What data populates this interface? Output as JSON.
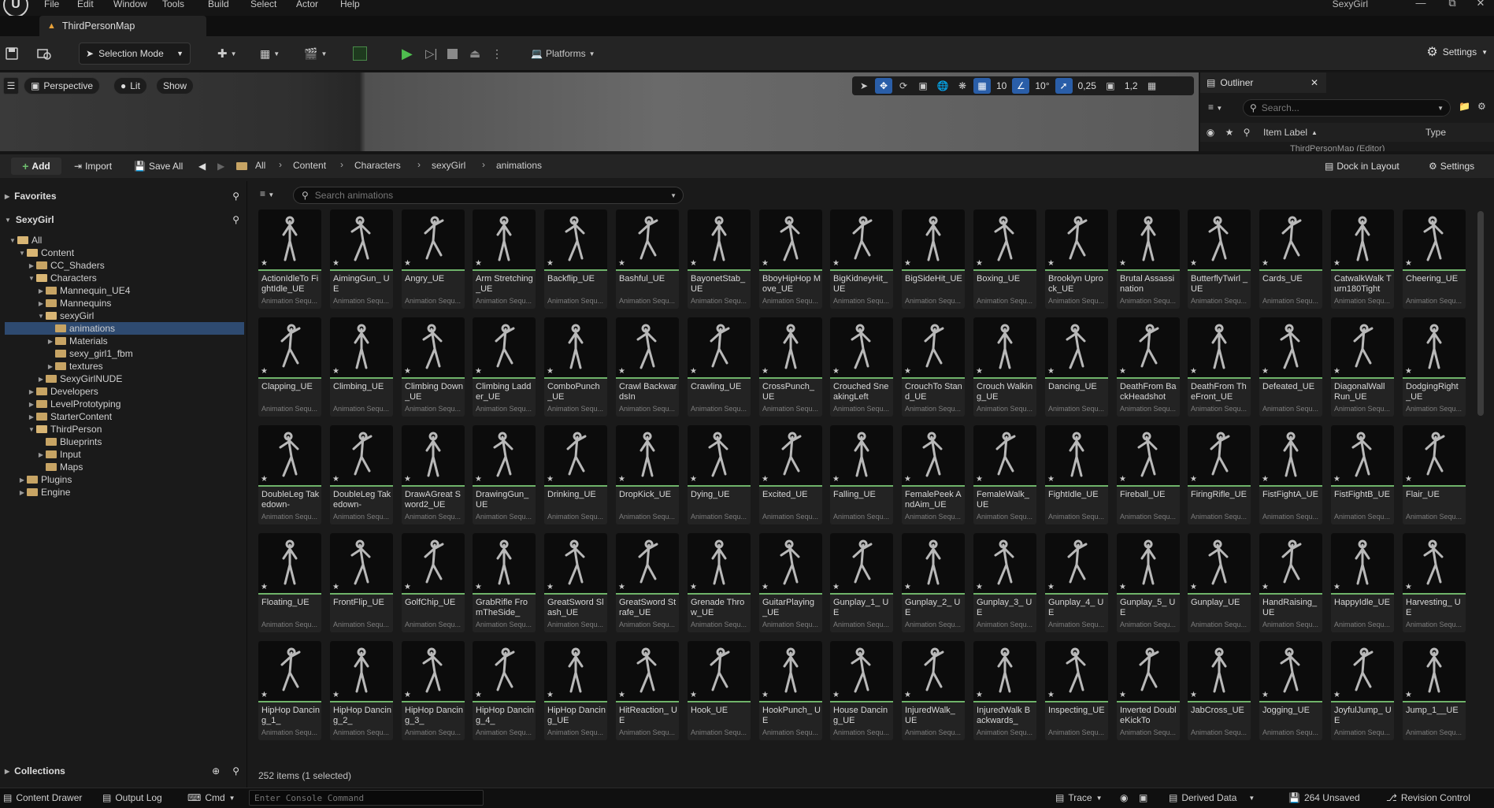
{
  "menu": {
    "items": [
      "File",
      "Edit",
      "Window",
      "Tools",
      "Build",
      "Select",
      "Actor",
      "Help"
    ],
    "project": "SexyGirl"
  },
  "tab": {
    "label": "ThirdPersonMap"
  },
  "toolbar": {
    "selection_mode": "Selection Mode",
    "platforms": "Platforms",
    "settings": "Settings"
  },
  "viewport": {
    "perspective": "Perspective",
    "lit": "Lit",
    "show": "Show",
    "grid_snap": "10",
    "rotation_snap": "10°",
    "scale_snap": "0,25",
    "camera_speed": "1,2"
  },
  "outliner": {
    "title": "Outliner",
    "search_placeholder": "Search...",
    "col_label": "Item Label",
    "col_type": "Type",
    "first_row": "ThirdPersonMap (Editor)"
  },
  "content_browser": {
    "add": "Add",
    "import": "Import",
    "save_all": "Save All",
    "breadcrumb": [
      "All",
      "Content",
      "Characters",
      "sexyGirl",
      "animations"
    ],
    "dock": "Dock in Layout",
    "settings": "Settings",
    "favorites": "Favorites",
    "project_root": "SexyGirl",
    "search_placeholder": "Search animations",
    "items_count": "252 items (1 selected)",
    "collections": "Collections",
    "asset_type": "Animation Sequ..."
  },
  "tree": [
    {
      "label": "All",
      "depth": 0,
      "open": true
    },
    {
      "label": "Content",
      "depth": 1,
      "open": true
    },
    {
      "label": "CC_Shaders",
      "depth": 2
    },
    {
      "label": "Characters",
      "depth": 2,
      "open": true
    },
    {
      "label": "Mannequin_UE4",
      "depth": 3
    },
    {
      "label": "Mannequins",
      "depth": 3
    },
    {
      "label": "sexyGirl",
      "depth": 3,
      "open": true
    },
    {
      "label": "animations",
      "depth": 4,
      "selected": true
    },
    {
      "label": "Materials",
      "depth": 4
    },
    {
      "label": "sexy_girl1_fbm",
      "depth": 4
    },
    {
      "label": "textures",
      "depth": 4
    },
    {
      "label": "SexyGirlNUDE",
      "depth": 3
    },
    {
      "label": "Developers",
      "depth": 2
    },
    {
      "label": "LevelPrototyping",
      "depth": 2
    },
    {
      "label": "StarterContent",
      "depth": 2
    },
    {
      "label": "ThirdPerson",
      "depth": 2,
      "open": true
    },
    {
      "label": "Blueprints",
      "depth": 3
    },
    {
      "label": "Input",
      "depth": 3
    },
    {
      "label": "Maps",
      "depth": 3
    },
    {
      "label": "Plugins",
      "depth": 1
    },
    {
      "label": "Engine",
      "depth": 1
    }
  ],
  "assets": [
    "ActionIdleTo FightIdle_UE",
    "AimingGun_ UE",
    "Angry_UE",
    "Arm Stretching_UE",
    "Backflip_UE",
    "Bashful_UE",
    "BayonetStab_ UE",
    "BboyHipHop Move_UE",
    "BigKidneyHit_ UE",
    "BigSideHit_UE",
    "Boxing_UE",
    "Brooklyn Uprock_UE",
    "Brutal Assassination",
    "ButterflyTwirl _UE",
    "Cards_UE",
    "CatwalkWalk Turn180Tight",
    "Cheering_UE",
    "Clapping_UE",
    "Climbing_UE",
    "Climbing Down_UE",
    "Climbing Ladder_UE",
    "ComboPunch _UE",
    "Crawl BackwardsIn",
    "Crawling_UE",
    "CrossPunch_ UE",
    "Crouched SneakingLeft",
    "CrouchTo Stand_UE",
    "Crouch Walking_UE",
    "Dancing_UE",
    "DeathFrom BackHeadshot",
    "DeathFrom TheFront_UE",
    "Defeated_UE",
    "DiagonalWall Run_UE",
    "DodgingRight _UE",
    "DoubleLeg Takedown-",
    "DoubleLeg Takedown-",
    "DrawAGreat Sword2_UE",
    "DrawingGun_ UE",
    "Drinking_UE",
    "DropKick_UE",
    "Dying_UE",
    "Excited_UE",
    "Falling_UE",
    "FemalePeek AndAim_UE",
    "FemaleWalk_ UE",
    "FightIdle_UE",
    "Fireball_UE",
    "FiringRifle_UE",
    "FistFightA_UE",
    "FistFightB_UE",
    "Flair_UE",
    "Floating_UE",
    "FrontFlip_UE",
    "GolfChip_UE",
    "GrabRifle FromTheSide_",
    "GreatSword Slash_UE",
    "GreatSword Strafe_UE",
    "Grenade Throw_UE",
    "GuitarPlaying _UE",
    "Gunplay_1_ UE",
    "Gunplay_2_ UE",
    "Gunplay_3_ UE",
    "Gunplay_4_ UE",
    "Gunplay_5_ UE",
    "Gunplay_UE",
    "HandRaising_ UE",
    "HappyIdle_UE",
    "Harvesting_ UE",
    "HipHop Dancing_1_",
    "HipHop Dancing_2_",
    "HipHop Dancing_3_",
    "HipHop Dancing_4_",
    "HipHop Dancing_UE",
    "HitReaction_ UE",
    "Hook_UE",
    "HookPunch_ UE",
    "House Dancing_UE",
    "InjuredWalk_ UE",
    "InjuredWalk Backwards_",
    "Inspecting_UE",
    "Inverted DoubleKickTo",
    "JabCross_UE",
    "Jogging_UE",
    "JoyfulJump_ UE",
    "Jump_1__UE"
  ],
  "status": {
    "content_drawer": "Content Drawer",
    "output_log": "Output Log",
    "cmd": "Cmd",
    "console_placeholder": "Enter Console Command",
    "trace": "Trace",
    "derived_data": "Derived Data",
    "unsaved": "264 Unsaved",
    "revision": "Revision Control"
  }
}
